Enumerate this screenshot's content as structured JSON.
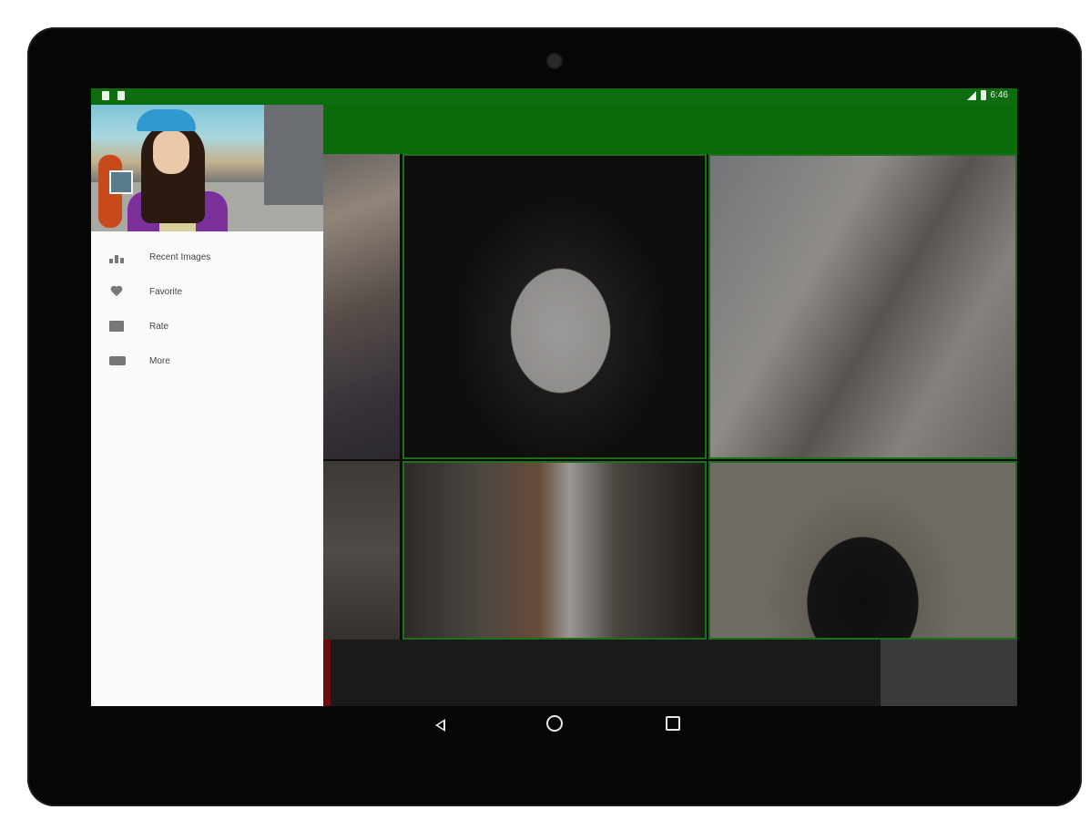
{
  "status_bar": {
    "time": "6:46",
    "left_icons": [
      "android-icon",
      "notification-icon"
    ],
    "right_icons": [
      "signal-icon",
      "battery-icon"
    ]
  },
  "drawer": {
    "menu_items": [
      {
        "label": "Recent Images",
        "icon": "recent-images-icon"
      },
      {
        "label": "Favorite",
        "icon": "heart-icon"
      },
      {
        "label": "Rate",
        "icon": "rate-icon"
      },
      {
        "label": "More",
        "icon": "more-icon"
      }
    ]
  },
  "navigation_bar": {
    "buttons": [
      "back-icon",
      "home-icon",
      "recents-icon"
    ]
  },
  "colors": {
    "primary": "#0b6b0b",
    "status_bar": "#0d6c0d",
    "drawer_background": "#fafafa",
    "tile_border": "#1d6f1d"
  }
}
